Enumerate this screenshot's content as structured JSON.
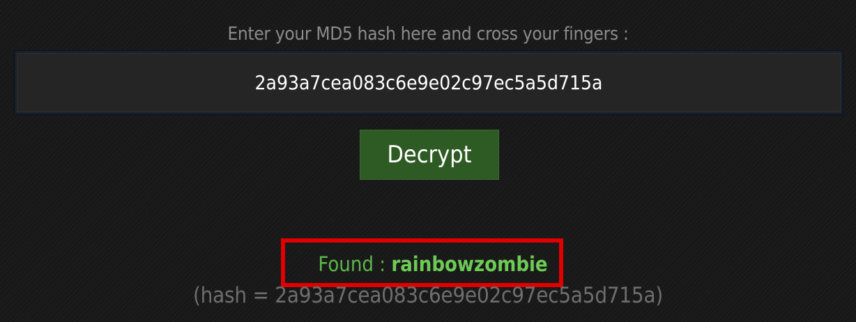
{
  "form": {
    "prompt": "Enter your MD5 hash here and cross your fingers :",
    "hash_value": "2a93a7cea083c6e9e02c97ec5a5d715a",
    "decrypt_label": "Decrypt"
  },
  "result": {
    "found_label": "Found :",
    "found_value": "rainbowzombie",
    "hash_echo": "(hash = 2a93a7cea083c6e9e02c97ec5a5d715a)"
  },
  "colors": {
    "button_green": "#2e5a24",
    "found_green": "#5cb84a",
    "highlight_red": "#e00000",
    "background": "#1a1a1a"
  }
}
